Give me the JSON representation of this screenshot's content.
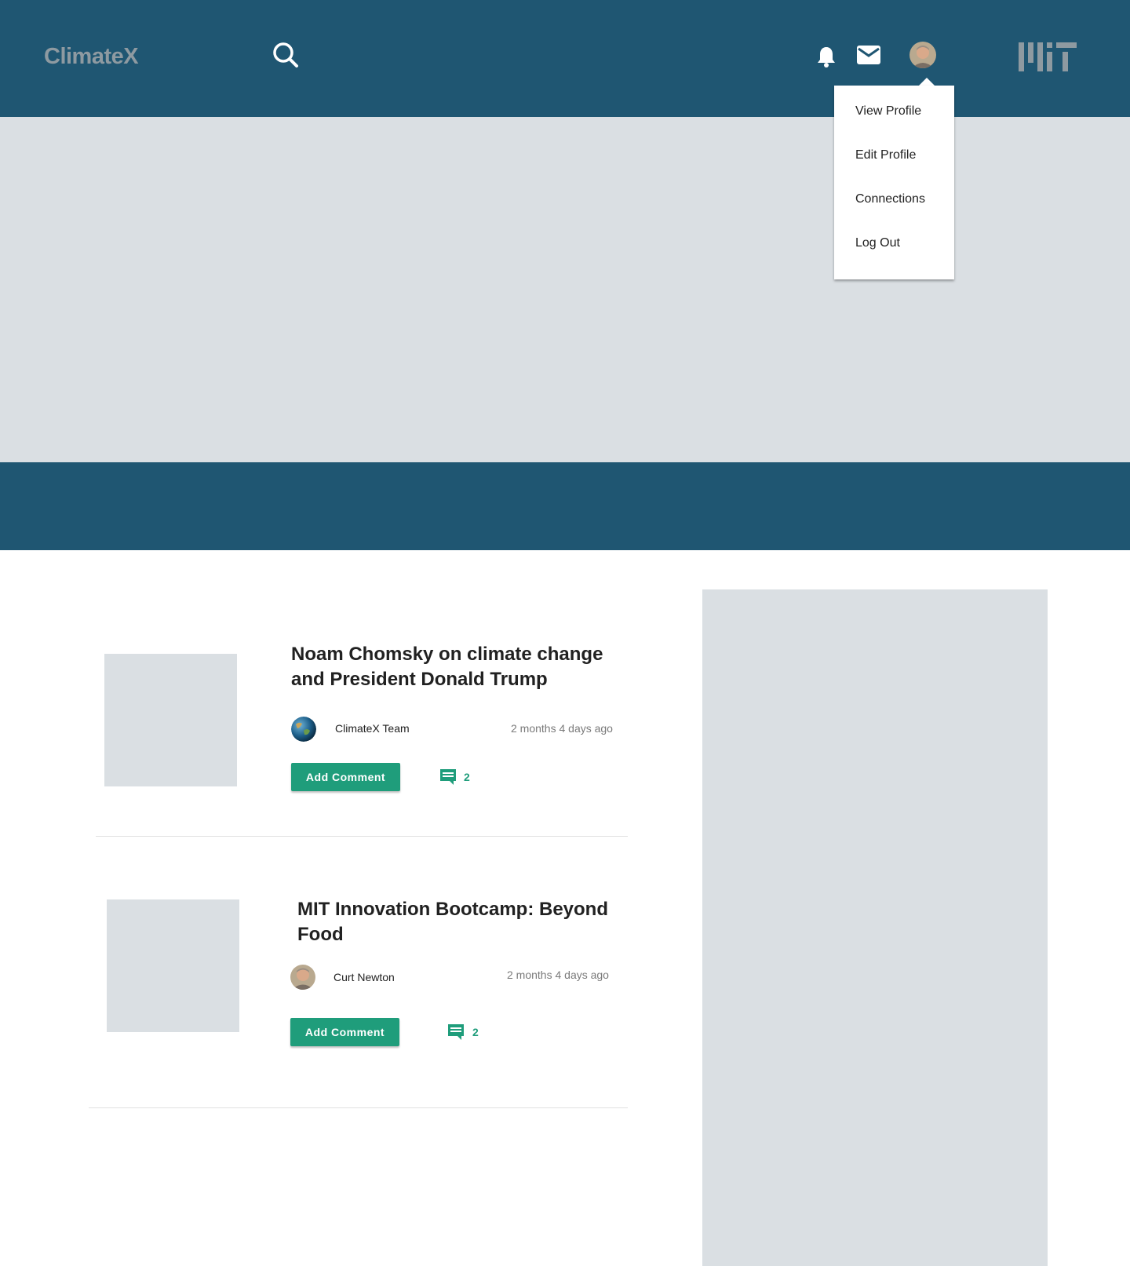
{
  "header": {
    "logo": "ClimateX",
    "icons": [
      "search-icon",
      "bell-icon",
      "mail-icon",
      "mit-logo"
    ],
    "background": "#1f5672"
  },
  "profile_menu": {
    "items": [
      {
        "label": "View Profile"
      },
      {
        "label": "Edit Profile"
      },
      {
        "label": "Connections"
      },
      {
        "label": "Log Out"
      }
    ]
  },
  "posts": [
    {
      "title": "Noam Chomsky on climate change and President Donald Trump",
      "author": "ClimateX Team",
      "time": "2 months 4 days ago",
      "button_label": "Add Comment",
      "comment_count": "2"
    },
    {
      "title": "MIT Innovation Bootcamp: Beyond Food",
      "author": "Curt Newton",
      "time": "2 months 4 days ago",
      "button_label": "Add Comment",
      "comment_count": "2"
    }
  ],
  "colors": {
    "brand": "#1f5672",
    "accent": "#1f9d7b",
    "placeholder": "#dadfe3"
  }
}
